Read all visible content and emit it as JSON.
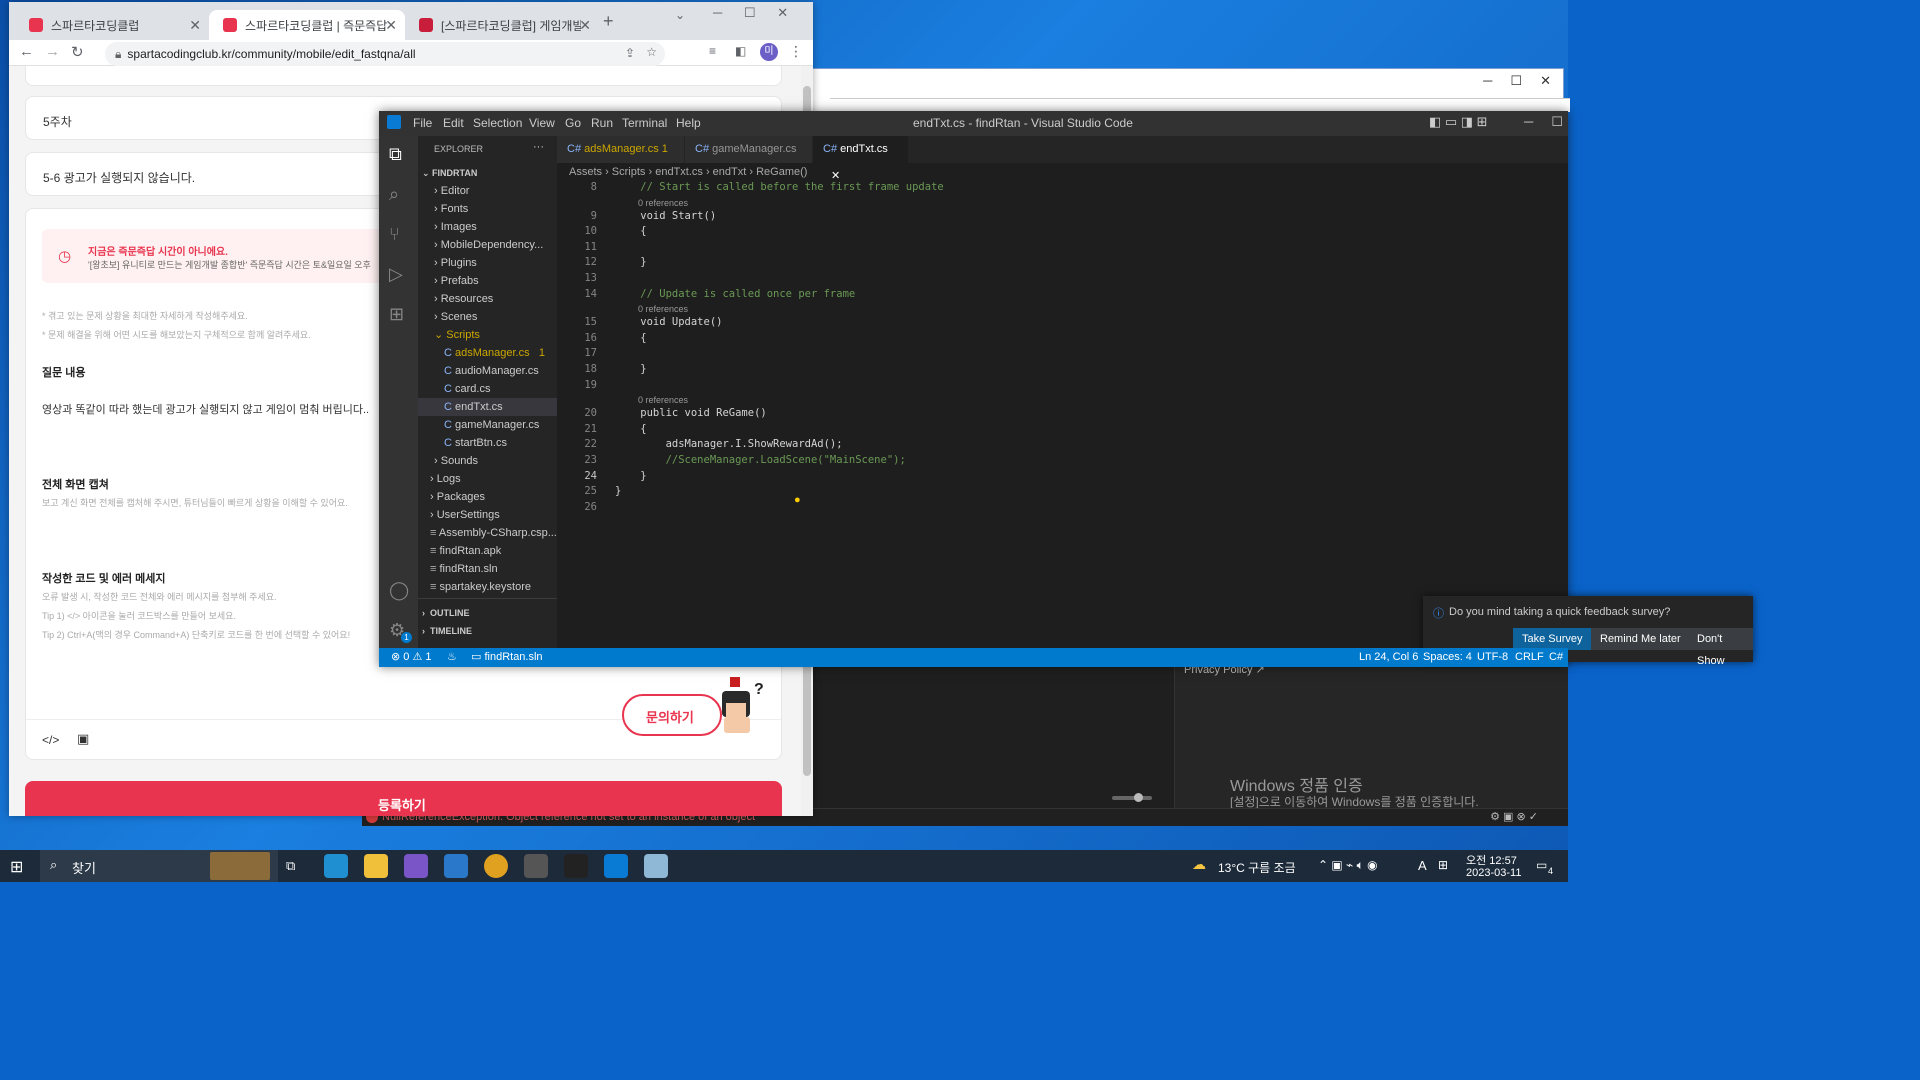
{
  "chrome": {
    "tabs": [
      {
        "title": "스파르타코딩클럽"
      },
      {
        "title": "스파르타코딩클럽 | 즉문즉답"
      },
      {
        "title": "[스파르타코딩클럽] 게임개발 종"
      }
    ],
    "url": "spartacodingclub.kr/community/mobile/edit_fastqna/all",
    "profile_initial": "미"
  },
  "page": {
    "week": "5주차",
    "title": "5-6 광고가 실행되지 않습니다.",
    "notice_title": "지금은 즉문즉답 시간이 아니에요.",
    "notice_body": "'[왕초보] 유니티로 만드는 게임개발 종합반' 즉문즉답 시간은 토&일요일 오후",
    "hint1": "* 겪고 있는 문제 상황을 최대한 자세하게 작성해주세요.",
    "hint2": "* 문제 해결을 위해 어떤 시도를 해보았는지 구체적으로 함께 알려주세요.",
    "q_label": "질문 내용",
    "q_body": "영상과 똑같이 따라 했는데 광고가 실행되지 않고 게임이 멈춰 버립니다..",
    "cap_label": "전체 화면 캡쳐",
    "cap_hint": "보고 계신 화면 전체를 캡처해 주시면, 튜터님들이 빠르게 상황을 이해할 수 있어요.",
    "code_label": "작성한 코드 및 에러 메세지",
    "code_hint1": "오류 발생 시, 작성한 코드 전체와 에러 메시지를 첨부해 주세요.",
    "code_hint2": "Tip 1) </> 아이콘을 눌러 코드박스를 만들어 보세요.",
    "code_hint3": "Tip 2) Ctrl+A(맥의 경우 Command+A) 단축키로 코드를 한 번에 선택할 수 있어요!",
    "ask_button": "문의하기",
    "submit_button": "등록하기"
  },
  "vscode": {
    "window_title": "endTxt.cs - findRtan - Visual Studio Code",
    "menu": [
      "File",
      "Edit",
      "Selection",
      "View",
      "Go",
      "Run",
      "Terminal",
      "Help"
    ],
    "explorer_title": "EXPLORER",
    "project": "FINDRTAN",
    "tree": [
      {
        "label": "Editor",
        "type": "folder"
      },
      {
        "label": "Fonts",
        "type": "folder"
      },
      {
        "label": "Images",
        "type": "folder"
      },
      {
        "label": "MobileDependency...",
        "type": "folder"
      },
      {
        "label": "Plugins",
        "type": "folder"
      },
      {
        "label": "Prefabs",
        "type": "folder"
      },
      {
        "label": "Resources",
        "type": "folder"
      },
      {
        "label": "Scenes",
        "type": "folder"
      },
      {
        "label": "Scripts",
        "type": "folder-open"
      },
      {
        "label": "adsManager.cs",
        "type": "file",
        "badge": "1"
      },
      {
        "label": "audioManager.cs",
        "type": "file"
      },
      {
        "label": "card.cs",
        "type": "file"
      },
      {
        "label": "endTxt.cs",
        "type": "file"
      },
      {
        "label": "gameManager.cs",
        "type": "file"
      },
      {
        "label": "startBtn.cs",
        "type": "file"
      },
      {
        "label": "Sounds",
        "type": "folder"
      },
      {
        "label": "Logs",
        "type": "folder"
      },
      {
        "label": "Packages",
        "type": "folder"
      },
      {
        "label": "UserSettings",
        "type": "folder"
      },
      {
        "label": "Assembly-CSharp.csp...",
        "type": "other"
      },
      {
        "label": "findRtan.apk",
        "type": "other"
      },
      {
        "label": "findRtan.sln",
        "type": "other"
      },
      {
        "label": "spartakey.keystore",
        "type": "other"
      }
    ],
    "outline": "OUTLINE",
    "timeline": "TIMELINE",
    "tabs": [
      {
        "label": "adsManager.cs",
        "badge": "1"
      },
      {
        "label": "gameManager.cs",
        "badge": ""
      },
      {
        "label": "endTxt.cs",
        "badge": ""
      }
    ],
    "breadcrumb": [
      "Assets",
      "Scripts",
      "endTxt.cs",
      "endTxt",
      "ReGame()"
    ],
    "code": [
      {
        "n": "8",
        "t": "    // Start is called before the first frame update",
        "c": "comment"
      },
      {
        "n": "",
        "t": "0 references",
        "c": "ref"
      },
      {
        "n": "9",
        "t": "    void Start()",
        "c": "code"
      },
      {
        "n": "10",
        "t": "    {",
        "c": "code"
      },
      {
        "n": "11",
        "t": "",
        "c": "code"
      },
      {
        "n": "12",
        "t": "    }",
        "c": "code"
      },
      {
        "n": "13",
        "t": "",
        "c": "code"
      },
      {
        "n": "14",
        "t": "    // Update is called once per frame",
        "c": "comment"
      },
      {
        "n": "",
        "t": "0 references",
        "c": "ref"
      },
      {
        "n": "15",
        "t": "    void Update()",
        "c": "code"
      },
      {
        "n": "16",
        "t": "    {",
        "c": "code"
      },
      {
        "n": "17",
        "t": "",
        "c": "code"
      },
      {
        "n": "18",
        "t": "    }",
        "c": "code"
      },
      {
        "n": "19",
        "t": "",
        "c": "code"
      },
      {
        "n": "",
        "t": "0 references",
        "c": "ref"
      },
      {
        "n": "20",
        "t": "    public void ReGame()",
        "c": "code"
      },
      {
        "n": "21",
        "t": "    {",
        "c": "code"
      },
      {
        "n": "22",
        "t": "        adsManager.I.ShowRewardAd();",
        "c": "code"
      },
      {
        "n": "23",
        "t": "        //SceneManager.LoadScene(\"MainScene\");",
        "c": "comment"
      },
      {
        "n": "24",
        "t": "    }",
        "c": "code"
      },
      {
        "n": "25",
        "t": "}",
        "c": "code"
      },
      {
        "n": "26",
        "t": "",
        "c": "code"
      }
    ],
    "toast": {
      "message": "Do you mind taking a quick feedback survey?",
      "take": "Take Survey",
      "remind": "Remind Me later",
      "dont": "Don't Show"
    },
    "status": {
      "errors": "0",
      "warnings": "1",
      "solution": "findRtan.sln",
      "position": "Ln 24, Col 6",
      "spaces": "Spaces: 4",
      "encoding": "UTF-8",
      "eol": "CRLF",
      "lang": "C#"
    }
  },
  "unity": {
    "privacy": "Privacy Policy",
    "error": "NullReferenceException: Object reference not set to an instance of an object",
    "watermark_title": "Windows 정품 인증",
    "watermark_body": "[설정]으로 이동하여 Windows를 정품 인증합니다."
  },
  "taskbar": {
    "search": "찾기",
    "weather": "13°C 구름 조금",
    "time": "오전 12:57",
    "date": "2023-03-11",
    "ime": "A",
    "notif_count": "4"
  },
  "colors": {
    "brand_red": "#e8344e",
    "vscode_blue": "#007acc",
    "toast_primary": "#0e639c"
  }
}
